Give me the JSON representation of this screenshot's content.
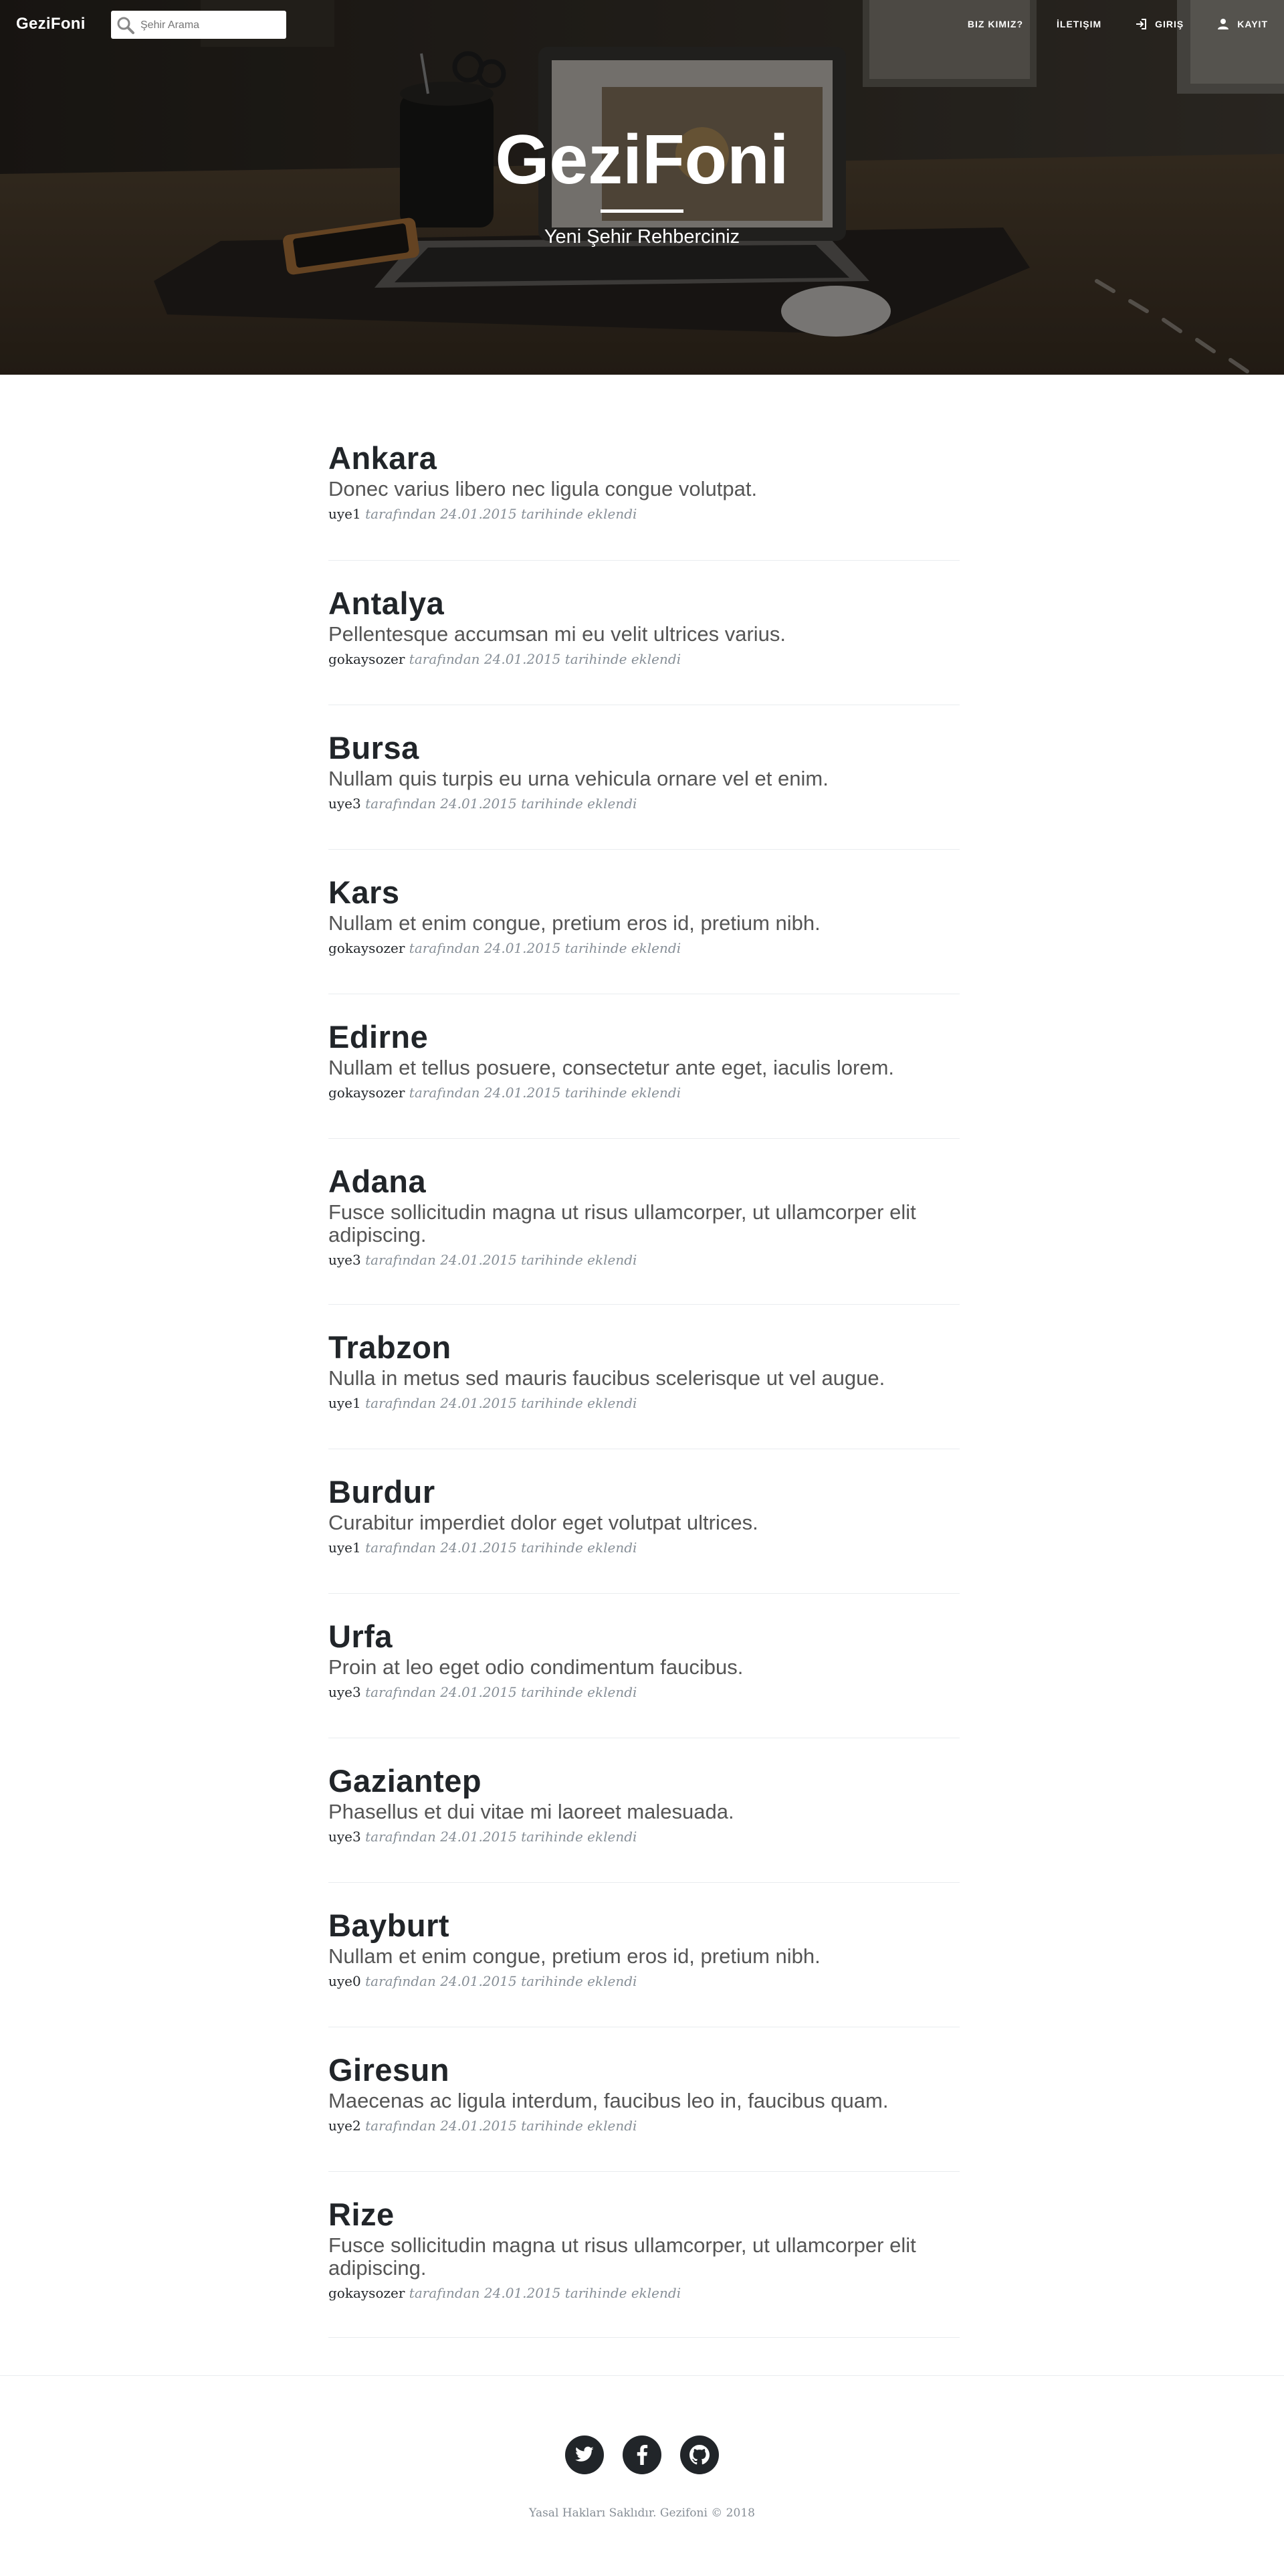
{
  "brand": "GeziFoni",
  "search": {
    "placeholder": "Şehir Arama"
  },
  "nav": {
    "about": "BIZ KIMIZ?",
    "contact": "İLETIŞIM",
    "login": "GIRIŞ",
    "register": "KAYIT"
  },
  "hero": {
    "title": "GeziFoni",
    "subtitle": "Yeni Şehir Rehberciniz"
  },
  "meta_suffix": " tarafından 24.01.2015 tarihinde eklendi",
  "posts": [
    {
      "title": "Ankara",
      "excerpt": "Donec varius libero nec ligula congue volutpat.",
      "author": "uye1"
    },
    {
      "title": "Antalya",
      "excerpt": "Pellentesque accumsan mi eu velit ultrices varius.",
      "author": "gokaysozer"
    },
    {
      "title": "Bursa",
      "excerpt": "Nullam quis turpis eu urna vehicula ornare vel et enim.",
      "author": "uye3"
    },
    {
      "title": "Kars",
      "excerpt": "Nullam et enim congue, pretium eros id, pretium nibh.",
      "author": "gokaysozer"
    },
    {
      "title": "Edirne",
      "excerpt": "Nullam et tellus posuere, consectetur ante eget, iaculis lorem.",
      "author": "gokaysozer"
    },
    {
      "title": "Adana",
      "excerpt": "Fusce sollicitudin magna ut risus ullamcorper, ut ullamcorper elit adipiscing.",
      "author": "uye3"
    },
    {
      "title": "Trabzon",
      "excerpt": "Nulla in metus sed mauris faucibus scelerisque ut vel augue.",
      "author": "uye1"
    },
    {
      "title": "Burdur",
      "excerpt": "Curabitur imperdiet dolor eget volutpat ultrices.",
      "author": "uye1"
    },
    {
      "title": "Urfa",
      "excerpt": "Proin at leo eget odio condimentum faucibus.",
      "author": "uye3"
    },
    {
      "title": "Gaziantep",
      "excerpt": "Phasellus et dui vitae mi laoreet malesuada.",
      "author": "uye3"
    },
    {
      "title": "Bayburt",
      "excerpt": "Nullam et enim congue, pretium eros id, pretium nibh.",
      "author": "uye0"
    },
    {
      "title": "Giresun",
      "excerpt": "Maecenas ac ligula interdum, faucibus leo in, faucibus quam.",
      "author": "uye2"
    },
    {
      "title": "Rize",
      "excerpt": "Fusce sollicitudin magna ut risus ullamcorper, ut ullamcorper elit adipiscing.",
      "author": "gokaysozer"
    }
  ],
  "social_icons": [
    "twitter-icon",
    "facebook-icon",
    "github-icon"
  ],
  "footer": {
    "copyright": "Yasal Hakları Saklıdır. Gezifoni © 2018"
  }
}
